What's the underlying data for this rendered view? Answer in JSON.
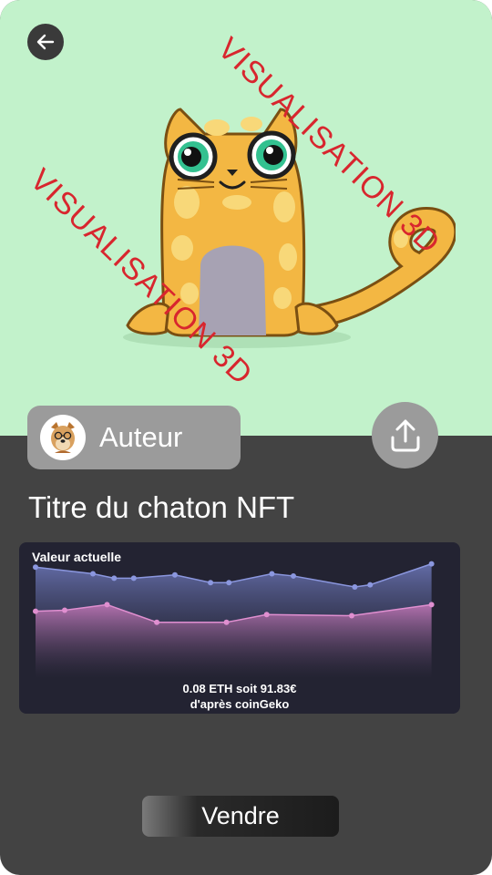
{
  "hero": {
    "background_color": "#c2f2cb",
    "watermark_text": "VISUALISATION 3D",
    "watermark_color": "#d8262e"
  },
  "icons": {
    "back": "arrow-left-icon",
    "share": "share-upload-icon"
  },
  "author": {
    "label": "Auteur"
  },
  "nft": {
    "title": "Titre du chaton NFT"
  },
  "chart_data": {
    "type": "area",
    "title": "Valeur actuelle",
    "x": [
      0,
      1,
      2,
      3,
      4,
      5,
      6,
      7,
      8,
      9,
      10,
      11,
      12,
      13
    ],
    "series": [
      {
        "color": "#8b97df",
        "values": [
          94,
          88,
          84,
          84,
          87,
          80,
          80,
          88,
          86,
          76,
          78,
          97
        ]
      },
      {
        "color": "#e08fd0",
        "values": [
          54,
          55,
          60,
          44,
          44,
          51,
          50,
          60
        ]
      }
    ],
    "ylim": [
      0,
      100
    ],
    "grid": false,
    "legend": "none"
  },
  "price": {
    "line1": "0.08 ETH soit 91.83€",
    "line2": "d'après coinGeko"
  },
  "sell": {
    "label": "Vendre"
  }
}
